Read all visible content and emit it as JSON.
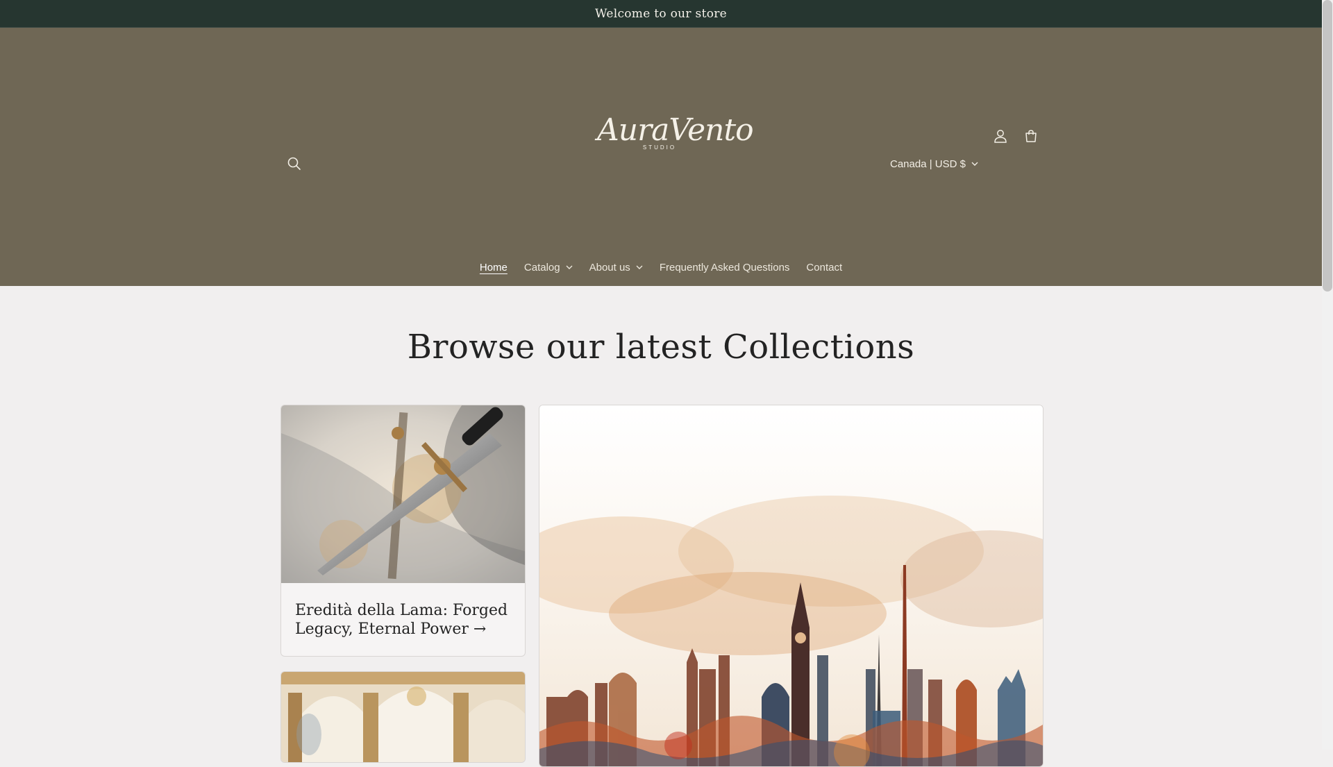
{
  "announcement": {
    "text": "Welcome to our store"
  },
  "header": {
    "logo": {
      "word": "AuraVento",
      "sub": "STUDIO"
    },
    "locale": {
      "label": "Canada | USD $"
    },
    "icons": {
      "search": "search-icon",
      "account": "account-icon",
      "cart": "cart-icon"
    }
  },
  "nav": {
    "items": [
      {
        "label": "Home",
        "active": true,
        "dropdown": false
      },
      {
        "label": "Catalog",
        "active": false,
        "dropdown": true
      },
      {
        "label": "About us",
        "active": false,
        "dropdown": true
      },
      {
        "label": "Frequently Asked Questions",
        "active": false,
        "dropdown": false
      },
      {
        "label": "Contact",
        "active": false,
        "dropdown": false
      }
    ]
  },
  "main": {
    "heading": "Browse our latest Collections",
    "collections": [
      {
        "title": "Eredità della Lama: Forged Legacy, Eternal Power",
        "arrow": "→"
      }
    ]
  },
  "colors": {
    "announcement_bg": "#263630",
    "header_bg": "#6f6755",
    "page_bg": "#f1efef"
  }
}
